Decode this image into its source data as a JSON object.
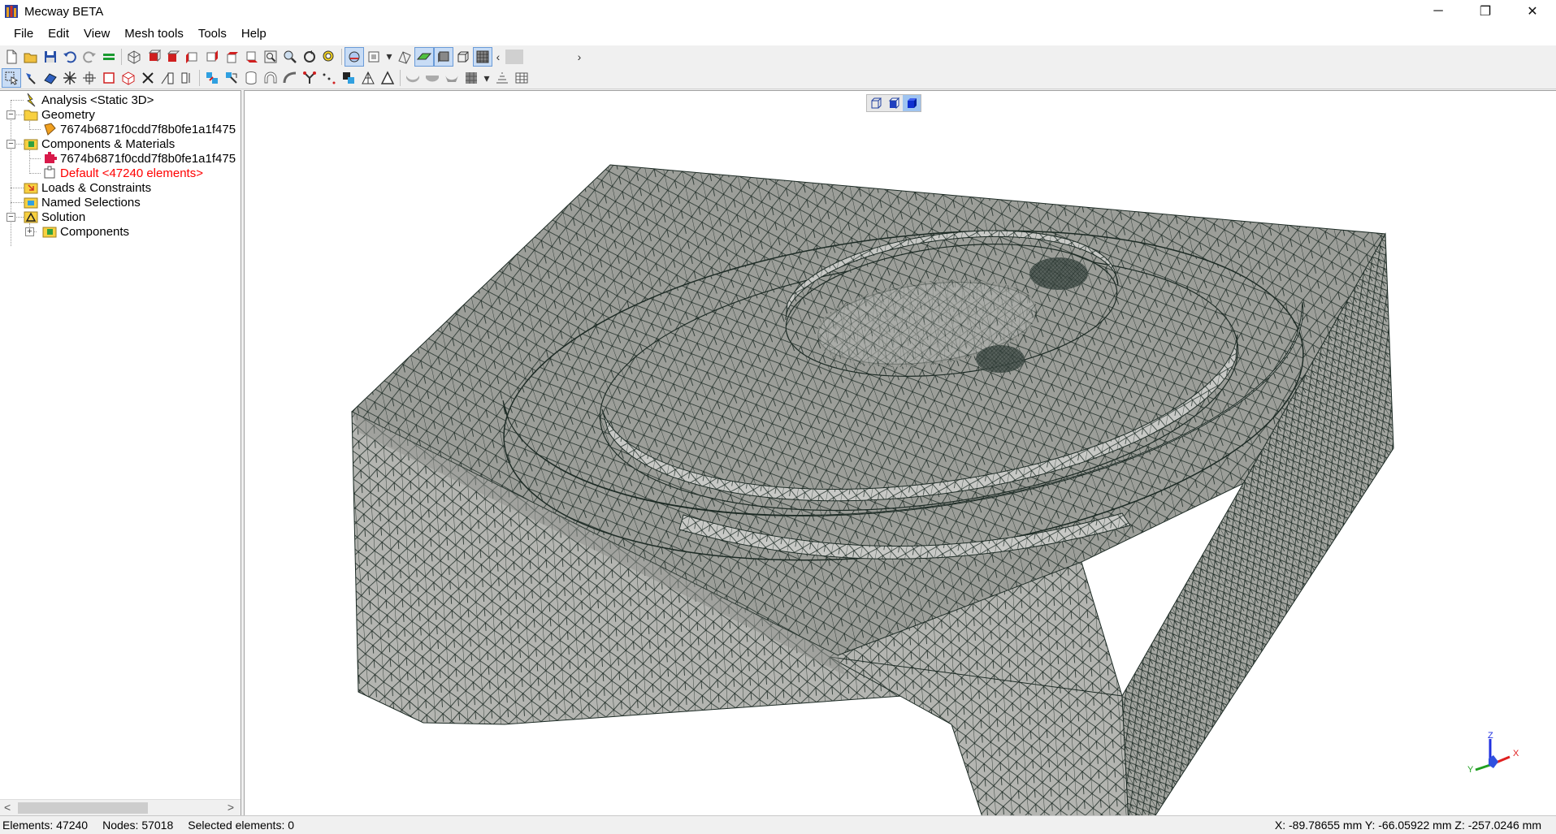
{
  "window": {
    "title": "Mecway BETA",
    "minimize_glyph": "─",
    "restore_glyph": "❐",
    "close_glyph": "✕"
  },
  "menu": [
    "File",
    "Edit",
    "View",
    "Mesh tools",
    "Tools",
    "Help"
  ],
  "tree": {
    "analysis": "Analysis <Static 3D>",
    "geometry": "Geometry",
    "geometry_file": "7674b6871f0cdd7f8b0fe1a1f475",
    "components": "Components & Materials",
    "component_file": "7674b6871f0cdd7f8b0fe1a1f475",
    "default_material": "Default <47240 elements>",
    "loads": "Loads & Constraints",
    "named_selections": "Named Selections",
    "solution": "Solution",
    "solution_components": "Components"
  },
  "scroll": {
    "left": "<",
    "right": ">"
  },
  "status": {
    "elements": "Elements: 47240",
    "nodes": "Nodes: 57018",
    "selected": "Selected elements: 0",
    "coords": "X: -89.78655 mm Y: -66.05922 mm Z: -257.0246 mm"
  },
  "triad": {
    "x": "X",
    "y": "Y",
    "z": "Z"
  },
  "colors": {
    "mesh_face": "#a8aaa5",
    "mesh_top": "#9c9e99",
    "mesh_light": "#c8c9c6",
    "mesh_line": "#1c2a24",
    "selection_red": "#ff0000"
  }
}
